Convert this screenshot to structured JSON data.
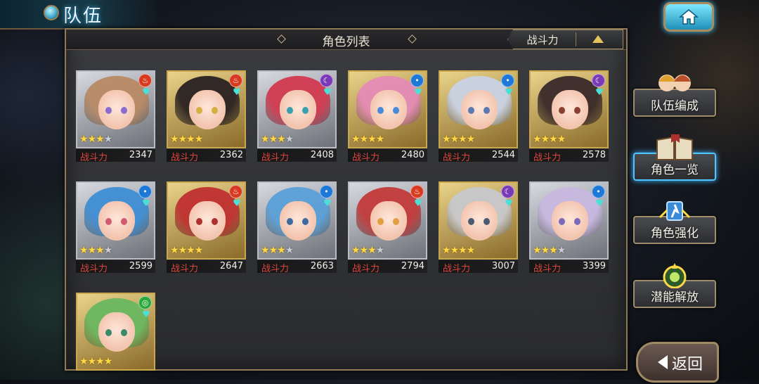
{
  "header": {
    "title": "队伍"
  },
  "panel": {
    "title": "角色列表",
    "sort_label": "战斗力"
  },
  "power_label": "战斗力",
  "characters": [
    {
      "power": "2347",
      "element": "fire",
      "stars": 3,
      "max_stars": 4,
      "frame": "silver",
      "hair": "#b88a64",
      "eyes": "#8a6bd0"
    },
    {
      "power": "2362",
      "element": "fire",
      "stars": 4,
      "max_stars": 4,
      "frame": "gold",
      "hair": "#2a2222",
      "eyes": "#d4b040"
    },
    {
      "power": "2408",
      "element": "dark",
      "stars": 3,
      "max_stars": 4,
      "frame": "silver",
      "hair": "#d23a50",
      "eyes": "#3aa0b0"
    },
    {
      "power": "2480",
      "element": "water",
      "stars": 4,
      "max_stars": 4,
      "frame": "gold",
      "hair": "#e58bb6",
      "eyes": "#4a8ad8"
    },
    {
      "power": "2544",
      "element": "water",
      "stars": 4,
      "max_stars": 4,
      "frame": "gold",
      "hair": "#c9d2e4",
      "eyes": "#5a7ab0"
    },
    {
      "power": "2578",
      "element": "dark",
      "stars": 4,
      "max_stars": 4,
      "frame": "gold",
      "hair": "#3a2a2a",
      "eyes": "#8a4030"
    },
    {
      "power": "2599",
      "element": "water",
      "stars": 3,
      "max_stars": 4,
      "frame": "silver",
      "hair": "#3e8ed4",
      "eyes": "#d05a70"
    },
    {
      "power": "2647",
      "element": "fire",
      "stars": 4,
      "max_stars": 4,
      "frame": "gold",
      "hair": "#c03030",
      "eyes": "#b03030"
    },
    {
      "power": "2663",
      "element": "water",
      "stars": 3,
      "max_stars": 4,
      "frame": "silver",
      "hair": "#5aa0d8",
      "eyes": "#3a6aa0"
    },
    {
      "power": "2794",
      "element": "fire",
      "stars": 3,
      "max_stars": 4,
      "frame": "silver",
      "hair": "#c23a3a",
      "eyes": "#e0a040"
    },
    {
      "power": "3007",
      "element": "dark",
      "stars": 4,
      "max_stars": 4,
      "frame": "gold",
      "hair": "#c8c8cc",
      "eyes": "#4a5a70"
    },
    {
      "power": "3399",
      "element": "water",
      "stars": 3,
      "max_stars": 4,
      "frame": "silver",
      "hair": "#c8b8e0",
      "eyes": "#7a6ab8"
    },
    {
      "power": "",
      "element": "wind",
      "stars": 4,
      "max_stars": 4,
      "frame": "gold",
      "hair": "#6ab860",
      "eyes": "#3a8a6a"
    }
  ],
  "side_menu": [
    {
      "label": "队伍编成",
      "active": false,
      "icon": "party-icon"
    },
    {
      "label": "角色一览",
      "active": true,
      "icon": "book-icon"
    },
    {
      "label": "角色强化",
      "active": false,
      "icon": "enhance-icon"
    },
    {
      "label": "潜能解放",
      "active": false,
      "icon": "potential-icon"
    }
  ],
  "back_button": {
    "label": "返回"
  },
  "colors": {
    "fire": "#d83a20",
    "water": "#1e78d8",
    "dark": "#7a3ab8",
    "wind": "#2aa83a",
    "accent": "#4fc6ff",
    "power_label": "#e0453c"
  }
}
